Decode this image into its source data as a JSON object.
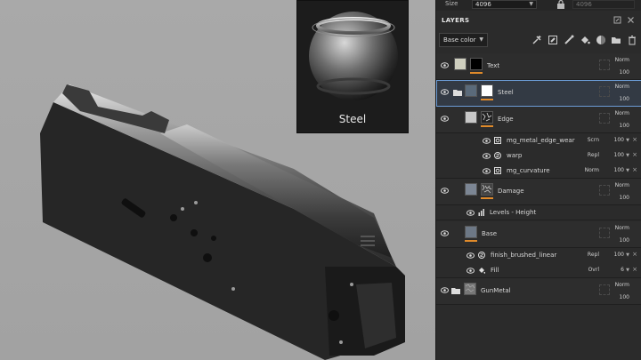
{
  "top_props": {
    "size_label": "Size",
    "size_value": "4096",
    "size_value_locked": "4096"
  },
  "layers_panel": {
    "title": "LAYERS",
    "channel": "Base color"
  },
  "preview": {
    "material_name": "Steel"
  },
  "layers": [
    {
      "name": "Text",
      "blend": "Norm",
      "opacity": "100"
    },
    {
      "name": "Steel",
      "blend": "Norm",
      "opacity": "100"
    },
    {
      "name": "Edge",
      "blend": "Norm",
      "opacity": "100"
    },
    {
      "name": "mg_metal_edge_wear",
      "blend": "Scrn",
      "opacity": "100"
    },
    {
      "name": "warp",
      "blend": "Repl",
      "opacity": "100"
    },
    {
      "name": "mg_curvature",
      "blend": "Norm",
      "opacity": "100"
    },
    {
      "name": "Damage",
      "blend": "Norm",
      "opacity": "100"
    },
    {
      "name": "Levels - Height",
      "blend": "",
      "opacity": ""
    },
    {
      "name": "Base",
      "blend": "Norm",
      "opacity": "100"
    },
    {
      "name": "finish_brushed_linear",
      "blend": "Repl",
      "opacity": "100"
    },
    {
      "name": "Fill",
      "blend": "Ovrl",
      "opacity": "6"
    },
    {
      "name": "GunMetal",
      "blend": "Norm",
      "opacity": "100"
    }
  ],
  "colors": {
    "accent_orange": "#e08a2a",
    "selection_blue": "#6c9cd6",
    "panel_bg": "#2b2b2b"
  }
}
